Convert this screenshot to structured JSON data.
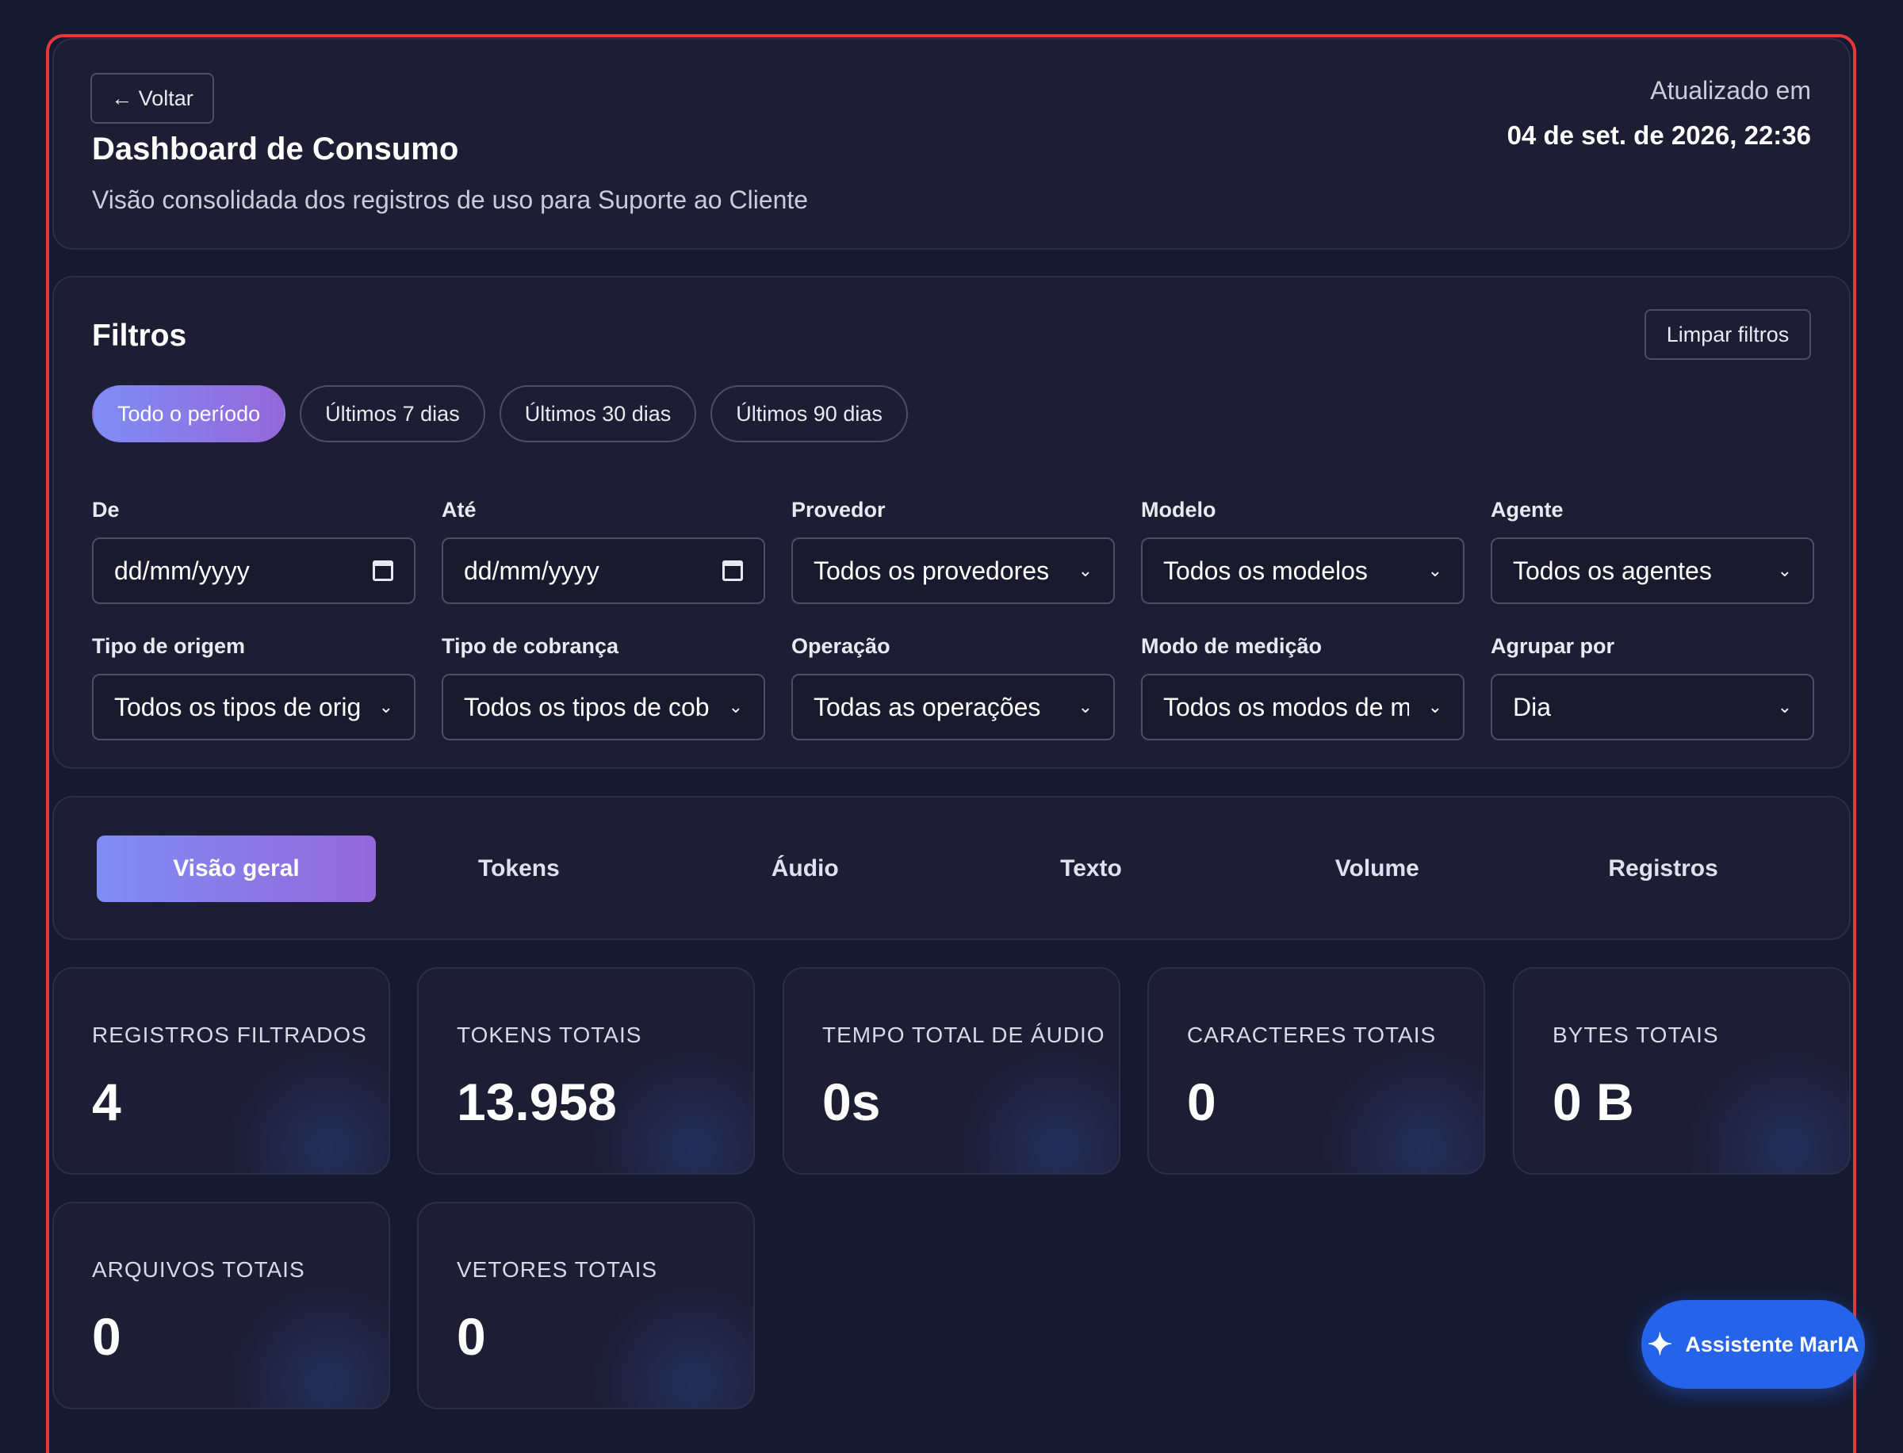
{
  "header": {
    "back_label": "← Voltar",
    "title": "Dashboard de Consumo",
    "subtitle": "Visão consolidada dos registros de uso para Suporte ao Cliente",
    "updated_label": "Atualizado em",
    "updated_value": "04 de set. de 2026, 22:36"
  },
  "filters": {
    "title": "Filtros",
    "clear_label": "Limpar filtros",
    "presets": [
      "Todo o período",
      "Últimos 7 dias",
      "Últimos 30 dias",
      "Últimos 90 dias"
    ],
    "active_preset": "Todo o período",
    "fields": {
      "from": {
        "label": "De",
        "placeholder": "dd/mm/yyyy"
      },
      "to": {
        "label": "Até",
        "placeholder": "dd/mm/yyyy"
      },
      "provider": {
        "label": "Provedor",
        "value": "Todos os provedores"
      },
      "model": {
        "label": "Modelo",
        "value": "Todos os modelos"
      },
      "agent": {
        "label": "Agente",
        "value": "Todos os agentes"
      },
      "origin_type": {
        "label": "Tipo de origem",
        "value": "Todos os tipos de origem"
      },
      "billing_type": {
        "label": "Tipo de cobrança",
        "value": "Todos os tipos de cobrança"
      },
      "operation": {
        "label": "Operação",
        "value": "Todas as operações"
      },
      "measure_mode": {
        "label": "Modo de medição",
        "value": "Todos os modos de medição"
      },
      "group_by": {
        "label": "Agrupar por",
        "value": "Dia"
      }
    }
  },
  "tabs": [
    "Visão geral",
    "Tokens",
    "Áudio",
    "Texto",
    "Volume",
    "Registros"
  ],
  "active_tab": "Visão geral",
  "stats": [
    {
      "label": "REGISTROS FILTRADOS",
      "value": "4"
    },
    {
      "label": "TOKENS TOTAIS",
      "value": "13.958"
    },
    {
      "label": "TEMPO TOTAL DE ÁUDIO",
      "value": "0s"
    },
    {
      "label": "CARACTERES TOTAIS",
      "value": "0"
    },
    {
      "label": "BYTES TOTAIS",
      "value": "0 B"
    },
    {
      "label": "ARQUIVOS TOTAIS",
      "value": "0"
    },
    {
      "label": "VETORES TOTAIS",
      "value": "0"
    }
  ],
  "assistant": {
    "label": "Assistente MarIA",
    "icon": "sparkle-icon"
  },
  "colors": {
    "background": "#151a30",
    "card": "#1d1d33",
    "accent_start": "#7f8cf5",
    "accent_end": "#9468d9",
    "frame_border": "#e5383b",
    "assistant": "#2563eb"
  }
}
